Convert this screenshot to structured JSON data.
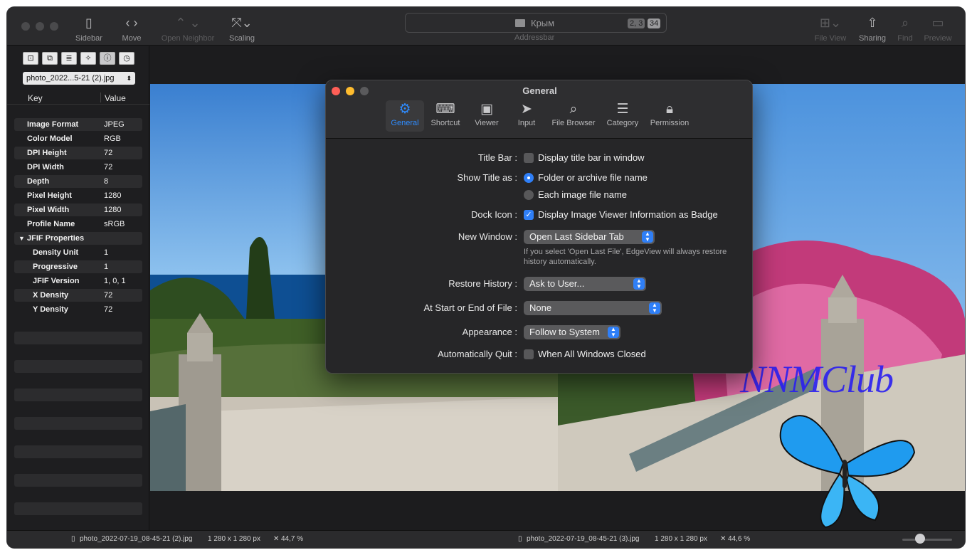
{
  "toolbar": {
    "sidebar_label": "Sidebar",
    "move_label": "Move",
    "open_neighbor_label": "Open Neighbor",
    "scaling_label": "Scaling",
    "addressbar_label": "Addressbar",
    "address_title": "Крым",
    "badge_left": "2, 3",
    "badge_right": "34",
    "file_view_label": "File View",
    "sharing_label": "Sharing",
    "find_label": "Find",
    "preview_label": "Preview"
  },
  "sidebar": {
    "selected_file": "photo_2022...5-21 (2).jpg",
    "col_key": "Key",
    "col_value": "Value",
    "rows": [
      {
        "key": "Image Format",
        "value": "JPEG"
      },
      {
        "key": "Color Model",
        "value": "RGB"
      },
      {
        "key": "DPI Height",
        "value": "72"
      },
      {
        "key": "DPI Width",
        "value": "72"
      },
      {
        "key": "Depth",
        "value": "8"
      },
      {
        "key": "Pixel Height",
        "value": "1280"
      },
      {
        "key": "Pixel Width",
        "value": "1280"
      },
      {
        "key": "Profile Name",
        "value": "sRGB"
      }
    ],
    "group_label": "JFIF Properties",
    "group_rows": [
      {
        "key": "Density Unit",
        "value": "1"
      },
      {
        "key": "Progressive",
        "value": "1"
      },
      {
        "key": "JFIF Version",
        "value": "1, 0, 1"
      },
      {
        "key": "X Density",
        "value": "72"
      },
      {
        "key": "Y Density",
        "value": "72"
      }
    ]
  },
  "dialog": {
    "title": "General",
    "tabs": [
      {
        "label": "General",
        "icon": "gear-icon"
      },
      {
        "label": "Shortcut",
        "icon": "keyboard-icon"
      },
      {
        "label": "Viewer",
        "icon": "image-icon"
      },
      {
        "label": "Input",
        "icon": "cursor-icon"
      },
      {
        "label": "File Browser",
        "icon": "folder-search-icon"
      },
      {
        "label": "Category",
        "icon": "list-icon"
      },
      {
        "label": "Permission",
        "icon": "lock-icon"
      }
    ],
    "title_bar_label": "Title Bar :",
    "title_bar_option": "Display title bar in window",
    "show_title_label": "Show Title as :",
    "show_title_option1": "Folder or archive file name",
    "show_title_option2": "Each image file name",
    "dock_icon_label": "Dock Icon :",
    "dock_icon_option": "Display Image Viewer Information as Badge",
    "new_window_label": "New Window :",
    "new_window_value": "Open Last Sidebar Tab",
    "new_window_hint": "If you select 'Open Last File', EdgeView will always restore history automatically.",
    "restore_history_label": "Restore History :",
    "restore_history_value": "Ask to User...",
    "start_end_label": "At Start or End of File :",
    "start_end_value": "None",
    "appearance_label": "Appearance :",
    "appearance_value": "Follow to System",
    "auto_quit_label": "Automatically Quit :",
    "auto_quit_option": "When All Windows Closed"
  },
  "status": {
    "left_file": "photo_2022-07-19_08-45-21 (2).jpg",
    "left_size": "1 280 x 1 280 px",
    "left_zoom": "44,7 %",
    "right_file": "photo_2022-07-19_08-45-21 (3).jpg",
    "right_size": "1 280 x 1 280 px",
    "right_zoom": "44,6 %"
  },
  "watermark": "NNMClub",
  "colors": {
    "accent": "#2f7ff7",
    "window_bg": "#1c1c1e",
    "toolbar_bg": "#2b2b2d"
  }
}
